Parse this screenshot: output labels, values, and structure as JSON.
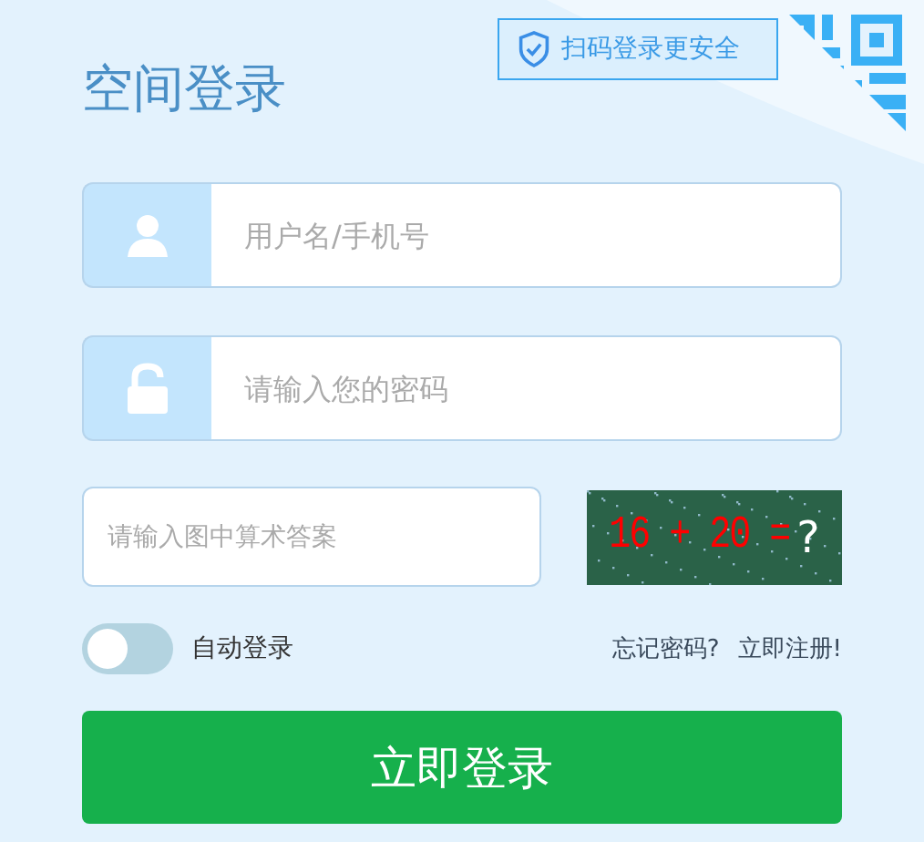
{
  "title": "空间登录",
  "qr_tip": {
    "text": "扫码登录更安全"
  },
  "username": {
    "placeholder": "用户名/手机号"
  },
  "password": {
    "placeholder": "请输入您的密码"
  },
  "captcha": {
    "placeholder": "请输入图中算术答案",
    "question": "16 + 20 =",
    "mark": "?"
  },
  "auto_login": {
    "label": "自动登录",
    "on": false
  },
  "links": [
    "忘记密码?",
    "立即注册!"
  ],
  "submit": "立即登录"
}
